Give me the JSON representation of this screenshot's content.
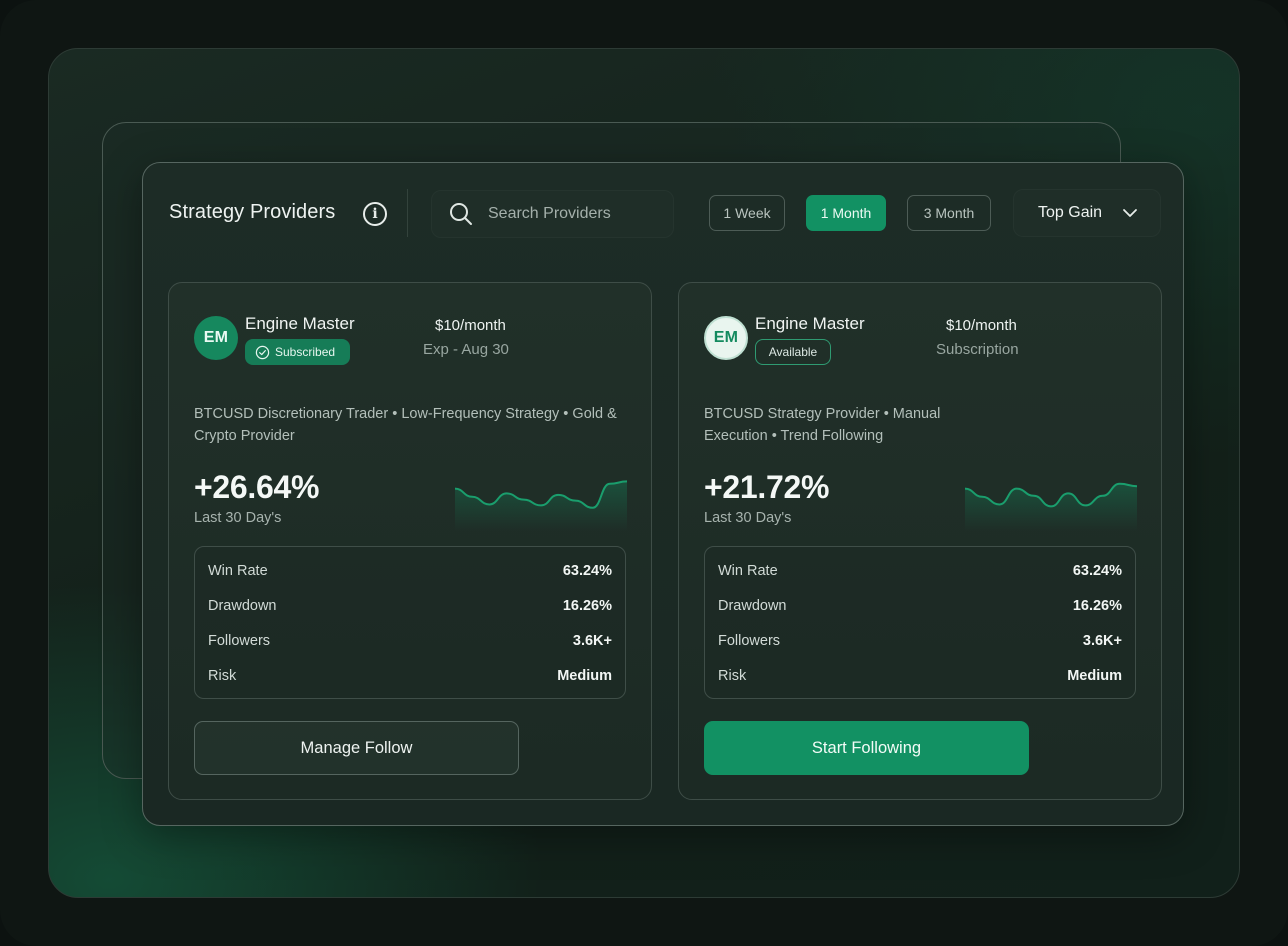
{
  "header": {
    "title": "Strategy Providers",
    "search_placeholder": "Search Providers",
    "periods": [
      "1 Week",
      "1 Month",
      "3 Month"
    ],
    "active_period": "1 Month",
    "sort_label": "Top Gain"
  },
  "cards": [
    {
      "initials": "EM",
      "name": "Engine Master",
      "badge": "Subscribed",
      "price": "$10/month",
      "price_sub": "Exp - Aug 30",
      "description": "BTCUSD Discretionary Trader • Low-Frequency Strategy • Gold & Crypto Provider",
      "return_pct": "+26.64%",
      "return_period": "Last 30 Day's",
      "sparkline_trend": [
        0.45,
        0.62,
        0.78,
        0.55,
        0.68,
        0.8,
        0.58,
        0.7,
        0.85,
        0.35,
        0.3
      ],
      "stats": [
        {
          "label": "Win Rate",
          "value": "63.24%"
        },
        {
          "label": "Drawdown",
          "value": "16.26%"
        },
        {
          "label": "Followers",
          "value": "3.6K+"
        },
        {
          "label": "Risk",
          "value": "Medium"
        }
      ],
      "button": "Manage Follow"
    },
    {
      "initials": "EM",
      "name": "Engine Master",
      "badge": "Available",
      "price": "$10/month",
      "price_sub": "Subscription",
      "description": "BTCUSD Strategy Provider • Manual Execution • Trend Following",
      "return_pct": "+21.72%",
      "return_period": "Last 30 Day's",
      "sparkline_trend": [
        0.45,
        0.62,
        0.78,
        0.45,
        0.6,
        0.82,
        0.55,
        0.8,
        0.6,
        0.35,
        0.4
      ],
      "stats": [
        {
          "label": "Win Rate",
          "value": "63.24%"
        },
        {
          "label": "Drawdown",
          "value": "16.26%"
        },
        {
          "label": "Followers",
          "value": "3.6K+"
        },
        {
          "label": "Risk",
          "value": "Medium"
        }
      ],
      "button": "Start Following"
    }
  ],
  "colors": {
    "accent": "#129163",
    "panel_bg": "#1d2c26",
    "background": "#0c1210"
  }
}
